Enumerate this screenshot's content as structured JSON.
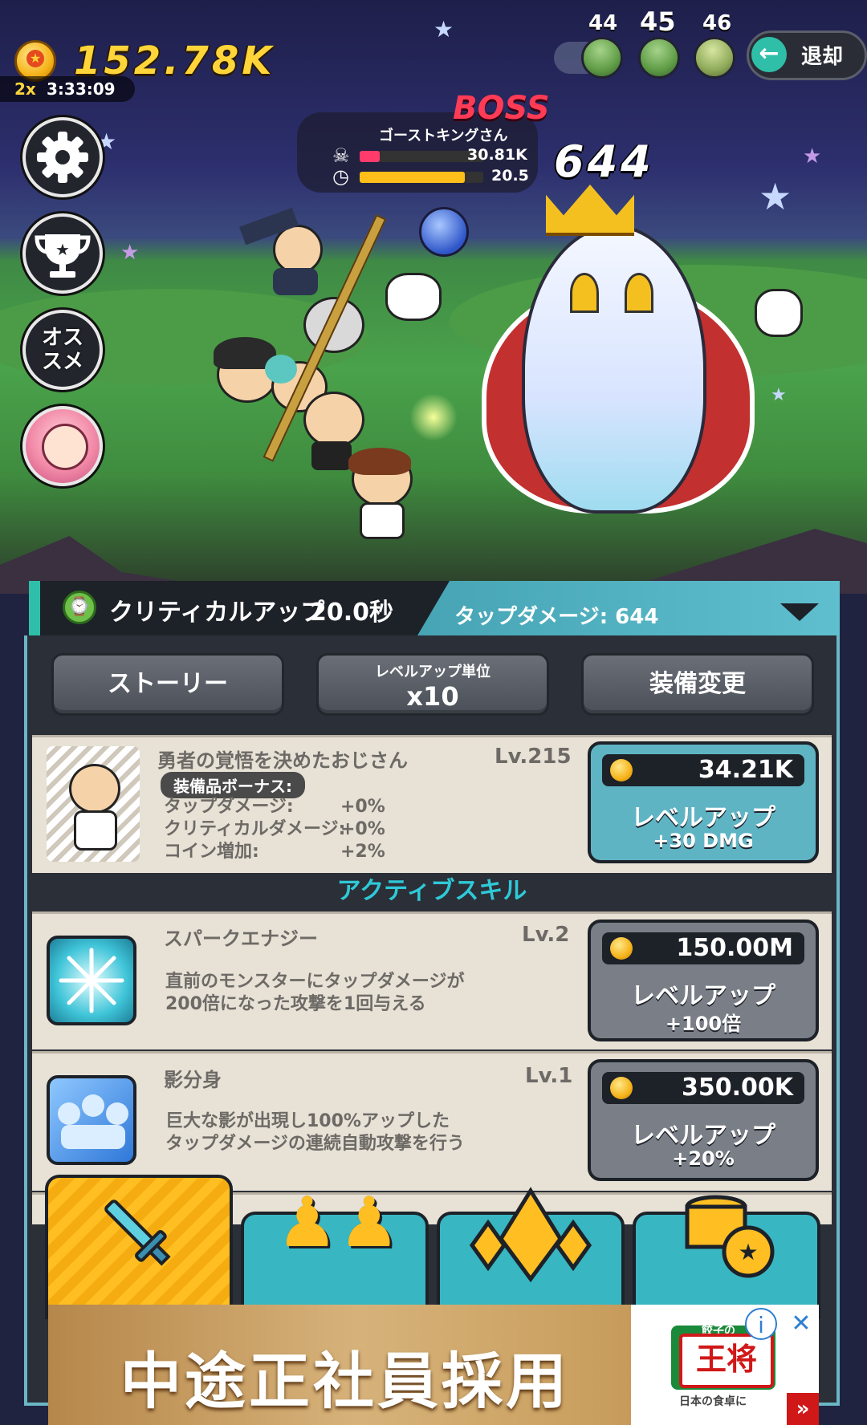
{
  "hud": {
    "coins": "152.78K",
    "multiplier": "2x",
    "timer": "3:33:09",
    "stages": [
      "44",
      "45",
      "46"
    ],
    "retreat_label": "退却"
  },
  "side_buttons": [
    {
      "name": "settings",
      "icon": "gear-icon"
    },
    {
      "name": "achievements",
      "icon": "trophy-icon"
    },
    {
      "name": "recommend",
      "label": "オススメ"
    },
    {
      "name": "character-portrait",
      "icon": "avatar"
    }
  ],
  "boss": {
    "title": "BOSS",
    "name": "ゴーストキングさん",
    "hp": "30.81K",
    "hp_fraction": 0.16,
    "time": "20.5",
    "time_fraction": 0.85,
    "damage_popup": "644"
  },
  "skill_bar": {
    "skill_name": "クリティカルアップ",
    "skill_time": "20.0秒",
    "tap_damage": "タップダメージ: 644"
  },
  "buttons": {
    "story": "ストーリー",
    "levelup_unit_label": "レベルアップ単位",
    "levelup_unit_value": "x10",
    "equip_change": "装備変更"
  },
  "hero_card": {
    "name": "勇者の覚悟を決めたおじさん",
    "level": "Lv.215",
    "bonus_title": "装備品ボーナス:",
    "bonus_rows": [
      {
        "label": "タップダメージ:",
        "value": "+0%"
      },
      {
        "label": "クリティカルダメージ:",
        "value": "+0%"
      },
      {
        "label": "コイン増加:",
        "value": "+2%"
      }
    ],
    "price": "34.21K",
    "action": "レベルアップ",
    "effect": "+30 DMG"
  },
  "section_header": "アクティブスキル",
  "skills": [
    {
      "name": "スパークエナジー",
      "level": "Lv.2",
      "desc1": "直前のモンスターにタップダメージが",
      "desc2": "200倍になった攻撃を1回与える",
      "price": "150.00M",
      "action": "レベルアップ",
      "effect": "+100倍"
    },
    {
      "name": "影分身",
      "level": "Lv.1",
      "desc1": "巨大な影が出現し100%アップした",
      "desc2": "タップダメージの連続自動攻撃を行う",
      "price": "350.00K",
      "action": "レベルアップ",
      "effect": "+20%"
    }
  ],
  "tabs": [
    {
      "icon": "sword-icon",
      "active": true
    },
    {
      "icon": "heroes-icon",
      "active": false
    },
    {
      "icon": "crystal-icon",
      "active": false
    },
    {
      "icon": "coin-stack-icon",
      "active": false
    }
  ],
  "ad": {
    "text": "中途正社員採用",
    "logo_text": "王将",
    "logo_top": "餃子の",
    "logo_bottom": "日本の食卓に"
  },
  "colors": {
    "accent_teal": "#2fbfa9",
    "buy_active": "#5fb4c4",
    "buy_inactive": "#7a7e86",
    "coin_gold": "#ffd53a",
    "boss_red": "#ff3b55"
  }
}
